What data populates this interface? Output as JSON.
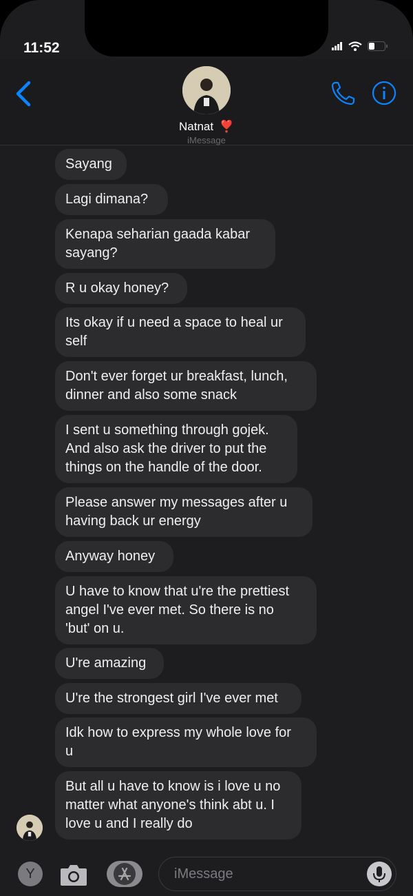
{
  "status_bar": {
    "time": "11:52"
  },
  "header": {
    "contact_name": "Natnat",
    "heart": "❣️",
    "service_label": "iMessage"
  },
  "messages": [
    {
      "lines": [
        "Sayang"
      ]
    },
    {
      "lines": [
        "Lagi dimana?"
      ]
    },
    {
      "lines": [
        "Kenapa seharian gaada kabar",
        "sayang?"
      ]
    },
    {
      "lines": [
        "R u okay honey?"
      ]
    },
    {
      "lines": [
        "Its okay if u need a space to heal ur",
        "self"
      ]
    },
    {
      "lines": [
        "Don't ever forget ur breakfast, lunch,",
        "dinner and also some snack"
      ]
    },
    {
      "lines": [
        "I sent u something through gojek.",
        "And also ask the driver to put the",
        "things on the handle of the door."
      ]
    },
    {
      "lines": [
        "Please answer my messages after u",
        "having back ur energy"
      ]
    },
    {
      "lines": [
        "Anyway honey"
      ]
    },
    {
      "lines": [
        "U have to know that u're the prettiest",
        "angel I've ever met. So there is no",
        "'but' on u."
      ]
    },
    {
      "lines": [
        "U're amazing"
      ]
    },
    {
      "lines": [
        "U're the strongest girl I've ever met"
      ]
    },
    {
      "lines": [
        "Idk how to express my whole love for",
        "u"
      ]
    },
    {
      "lines": [
        "But all u have to know is i love u no",
        "matter what anyone's think abt u. I",
        "love u and I really do"
      ]
    }
  ],
  "input_bar": {
    "apps_letter": "Y",
    "placeholder": "iMessage"
  },
  "colors": {
    "accent": "#0a84ff",
    "bubble": "#2c2c2e",
    "background": "#1d1d1f"
  },
  "icons": [
    "back-chevron-icon",
    "phone-icon",
    "info-icon",
    "camera-icon",
    "app-store-icon",
    "microphone-icon",
    "signal-icon",
    "wifi-icon",
    "battery-icon"
  ]
}
